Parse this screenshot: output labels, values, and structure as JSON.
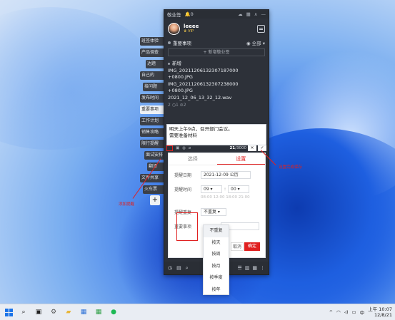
{
  "side_tags": [
    "班签体验",
    "产品调查",
    "达题",
    "自己的",
    "接问题",
    "发布时间",
    "重要事项",
    "工作计划",
    "销售攻略",
    "限行提醒",
    "面试安排",
    "翻译",
    "文件共享",
    "火车票"
  ],
  "widget": {
    "title": "敬业签",
    "bell_count": "0",
    "user": {
      "name": "leeee",
      "badge": "VIP"
    },
    "section_title": "重要事项",
    "filter": "全部",
    "new_button": "新增敬业签",
    "note": {
      "heading": "新增",
      "lines": [
        "IMG_20211206132307187000",
        "+0800.JPG",
        "IMG_20211206132307238000",
        "+0800.JPG",
        "2021_12_06_13_32_12.wav"
      ],
      "stats": "2  ◷1  ⊘2"
    },
    "input": {
      "line1": "明天上午9点，召开部门会议。",
      "line2": "需要准备材料",
      "counter_current": "21",
      "counter_max": "/3000",
      "cancel_glyph": "×",
      "confirm_glyph": "✓"
    },
    "settings": {
      "tab_left": "选择",
      "tab_right": "设置",
      "date_label": "提醒日期",
      "date_value": "2021-12-09 公历",
      "time_label": "提醒时间",
      "hour": "09",
      "minute": "00",
      "time_hints": "08:00  12:00  18:00  21:00",
      "repeat_label": "提醒重复",
      "repeat_value": "不重复",
      "advance_label": "重要事项",
      "cancel_label": "取消",
      "ok_label": "确定"
    },
    "repeat_options": [
      "不重复",
      "按天",
      "按周",
      "按月",
      "按季度",
      "按年"
    ]
  },
  "annotations": {
    "left": "添加提醒",
    "right": "设置完成保存"
  },
  "taskbar": {
    "time": "上午 10:07",
    "date": "12/8/21",
    "tray_caret": "^",
    "lang_icon": "中"
  },
  "colors": {
    "accent": "#e02020",
    "widget_bg": "#2d3139"
  }
}
